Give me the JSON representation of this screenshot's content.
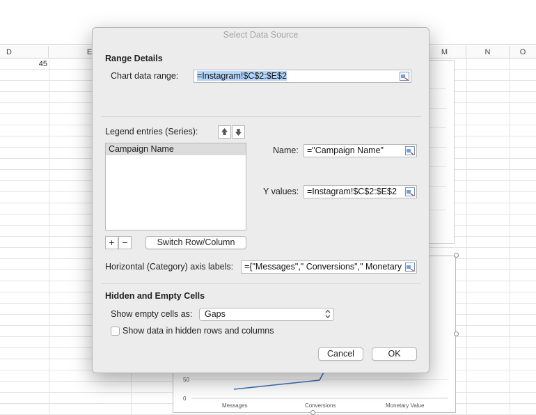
{
  "spreadsheet": {
    "columns": [
      "D",
      "E",
      "M",
      "N",
      "O"
    ],
    "cell_value": "45"
  },
  "background_chart": {
    "y_tick_labels": [
      "50",
      "0"
    ],
    "x_categories": [
      "Messages",
      "Conversions",
      "Monetary Value"
    ],
    "line_color": "#3e72c0"
  },
  "dialog": {
    "title": "Select Data Source",
    "range_details": {
      "heading": "Range Details",
      "chart_data_range_label": "Chart data range:",
      "chart_data_range_value": "=Instagram!$C$2:$E$2"
    },
    "legend": {
      "label": "Legend entries (Series):",
      "move_up_icon": "arrow-up-icon",
      "move_down_icon": "arrow-down-icon",
      "series": [
        "Campaign Name"
      ],
      "add_label": "+",
      "remove_label": "−",
      "switch_label": "Switch Row/Column"
    },
    "series_detail": {
      "name_label": "Name:",
      "name_value": "=\"Campaign Name\"",
      "y_values_label": "Y values:",
      "y_values_value": "=Instagram!$C$2:$E$2"
    },
    "axis_labels": {
      "label": "Horizontal (Category) axis labels:",
      "value": "={\"Messages\",\" Conversions\",\" Monetary"
    },
    "hidden_empty": {
      "heading": "Hidden and Empty Cells",
      "show_empty_label": "Show empty cells as:",
      "show_empty_value": "Gaps",
      "show_hidden_label": "Show data in hidden rows and columns",
      "show_hidden_checked": false
    },
    "buttons": {
      "cancel": "Cancel",
      "ok": "OK"
    }
  }
}
